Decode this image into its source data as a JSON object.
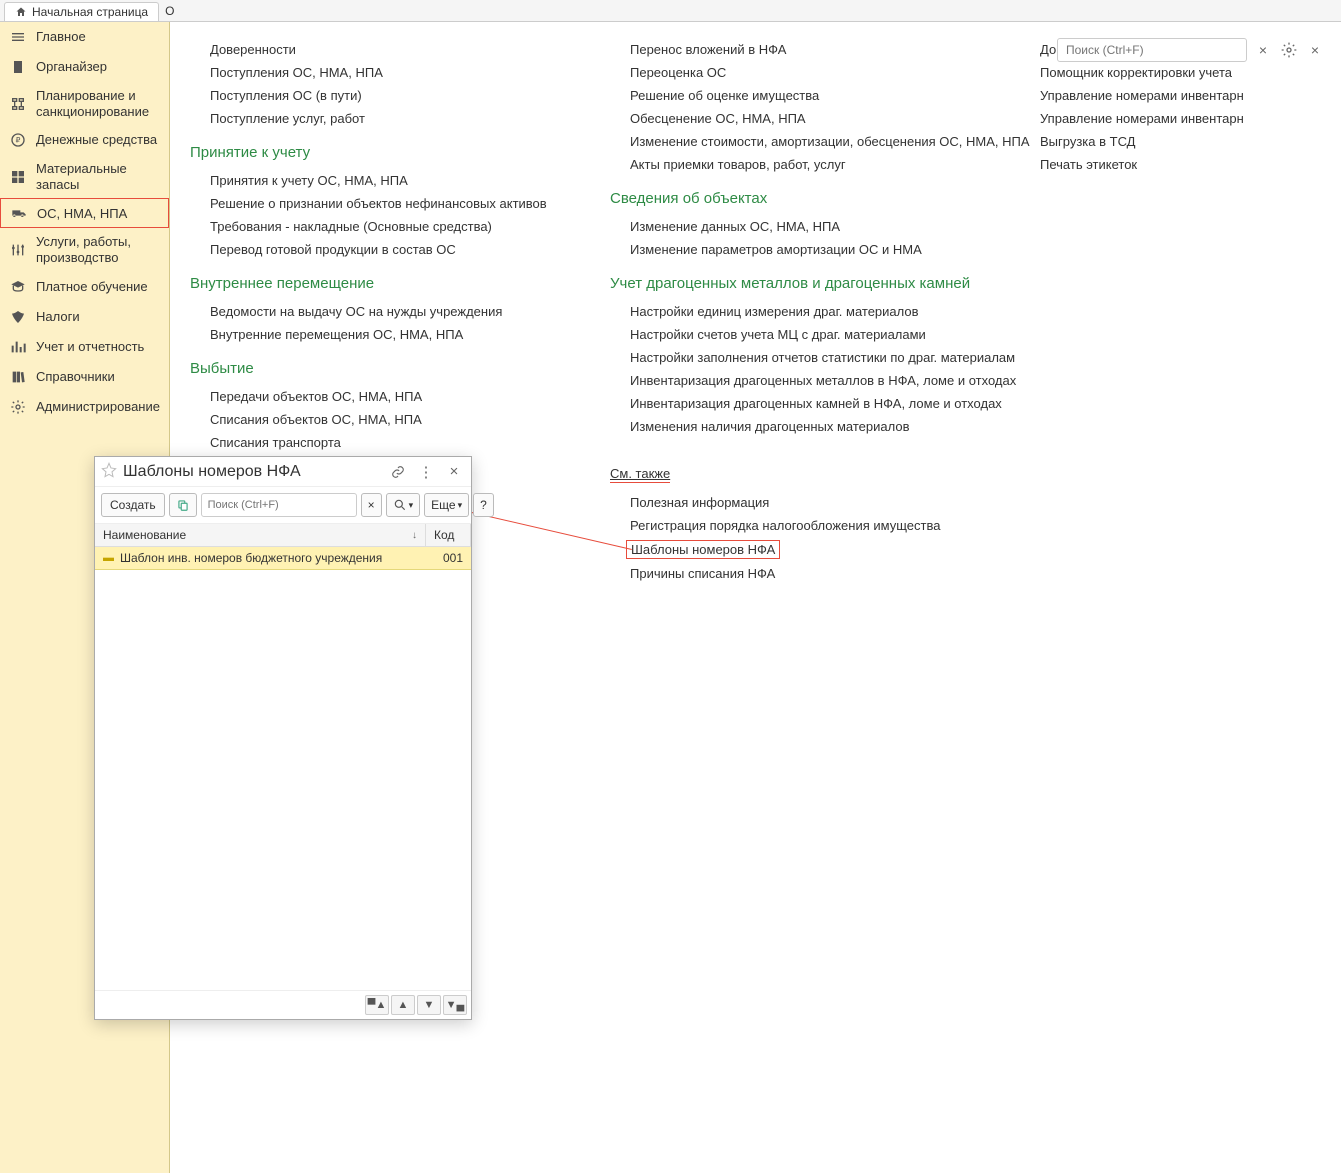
{
  "tabs": {
    "home": "Начальная страница",
    "trunc": "О"
  },
  "sidebar": {
    "items": [
      "Главное",
      "Органайзер",
      "Планирование и санкционирование",
      "Денежные средства",
      "Материальные запасы",
      "ОС, НМА, НПА",
      "Услуги, работы, производство",
      "Платное обучение",
      "Налоги",
      "Учет и отчетность",
      "Справочники",
      "Администрирование"
    ]
  },
  "topsearch_placeholder": "Поиск (Ctrl+F)",
  "col1": {
    "g0": [
      "Доверенности",
      "Поступления ОС, НМА, НПА",
      "Поступления ОС (в пути)",
      "Поступление услуг, работ"
    ],
    "h1": "Принятие к учету",
    "g1": [
      "Принятия к учету ОС, НМА, НПА",
      "Решение о признании объектов нефинансовых активов",
      "Требования - накладные (Основные средства)",
      "Перевод готовой продукции в состав ОС"
    ],
    "h2": "Внутреннее перемещение",
    "g2": [
      "Ведомости на выдачу ОС на нужды учреждения",
      "Внутренние перемещения ОС, НМА, НПА"
    ],
    "h3": "Выбытие",
    "g3": [
      "Передачи объектов ОС, НМА, НПА",
      "Списания объектов ОС, НМА, НПА",
      "Списания транспорта"
    ]
  },
  "col2": {
    "g0": [
      "Перенос вложений в НФА",
      "Переоценка ОС",
      "Решение об оценке имущества",
      "Обесценение ОС, НМА, НПА",
      "Изменение стоимости, амортизации, обесценения ОС, НМА, НПА",
      "Акты приемки товаров, работ, услуг"
    ],
    "h1": "Сведения об объектах",
    "g1": [
      "Изменение данных ОС, НМА, НПА",
      "Изменение параметров амортизации ОС и НМА"
    ],
    "h2": "Учет драгоценных металлов и драгоценных камней",
    "g2": [
      "Настройки единиц измерения драг. материалов",
      "Настройки счетов учета МЦ с драг. материалами",
      "Настройки заполнения отчетов статистики по драг. материалам",
      "Инвентаризация драгоценных металлов в НФА, ломе и отходах",
      "Инвентаризация драгоценных камней в НФА, ломе и отходах",
      "Изменения наличия драгоценных материалов"
    ],
    "h3": "См. также",
    "g3": [
      "Полезная информация",
      "Регистрация порядка налогообложения имущества",
      "Шаблоны номеров НФА",
      "Причины списания НФА"
    ]
  },
  "col3": {
    "g0": [
      "Дополнительные обработки",
      "Помощник корректировки учета",
      "Управление номерами инвентарн",
      "Управление номерами инвентарн",
      "Выгрузка в ТСД",
      "Печать этикеток"
    ]
  },
  "dialog": {
    "title": "Шаблоны номеров НФА",
    "create": "Создать",
    "search_placeholder": "Поиск (Ctrl+F)",
    "more": "Еще",
    "th_name": "Наименование",
    "th_code": "Код",
    "row_name": "Шаблон инв. номеров бюджетного учреждения",
    "row_code": "001"
  }
}
